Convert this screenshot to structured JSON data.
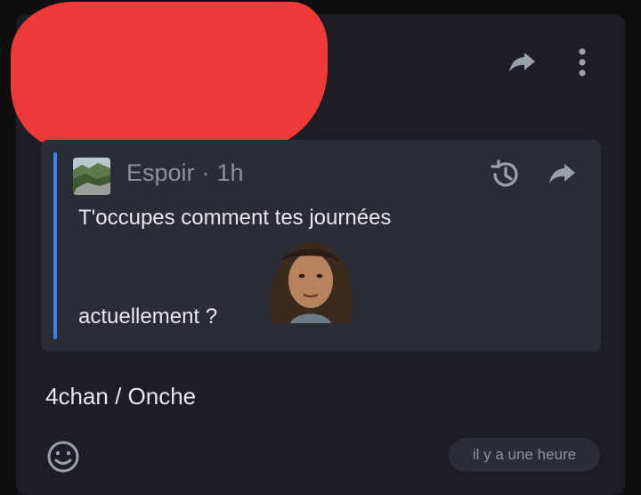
{
  "quote": {
    "author": "Espoir",
    "separator": "·",
    "time": "1h",
    "text_line1": "T'occupes comment tes journées",
    "text_line2": "actuellement ?"
  },
  "message": {
    "text": "4chan / Onche",
    "timestamp": "il y a une heure"
  },
  "colors": {
    "card_bg": "#1d1e23",
    "quote_bg": "#2a2d36",
    "accent_bar": "#3b82f6",
    "redaction": "#f03a3a",
    "muted_text": "#8c919c",
    "primary_text": "#e6e8ec"
  },
  "icons": {
    "header_share": "share-arrow-icon",
    "header_more": "more-vertical-icon",
    "quote_history": "history-icon",
    "quote_share": "share-arrow-icon",
    "emoji": "smiley-emoji-icon"
  }
}
